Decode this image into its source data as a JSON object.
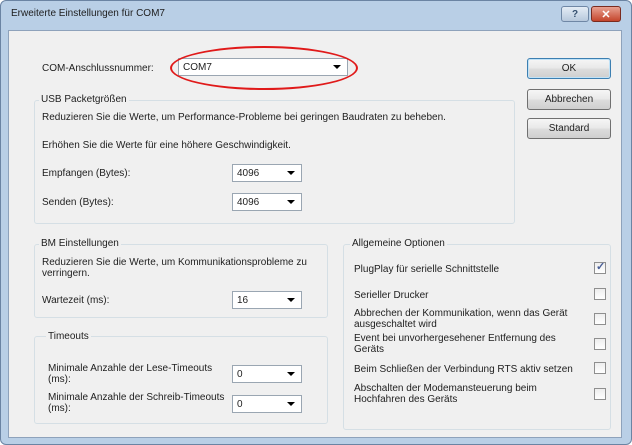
{
  "window": {
    "title": "Erweiterte Einstellungen für COM7",
    "help_icon_glyph": "?",
    "close_icon_glyph": "✕"
  },
  "com_port": {
    "label": "COM-Anschlussnummer:",
    "value": "COM7"
  },
  "usb": {
    "legend": "USB Packetgrößen",
    "text1": "Reduzieren Sie die Werte, um Performance-Probleme bei geringen Baudraten zu beheben.",
    "text2": "Erhöhen Sie die Werte für eine höhere Geschwindigkeit.",
    "receive_label": "Empfangen (Bytes):",
    "receive_value": "4096",
    "send_label": "Senden (Bytes):",
    "send_value": "4096"
  },
  "bm": {
    "legend": "BM Einstellungen",
    "text": "Reduzieren Sie die Werte, um Kommunikationsprobleme zu verringern.",
    "latency_label": "Wartezeit (ms):",
    "latency_value": "16"
  },
  "timeouts": {
    "legend": "Timeouts",
    "read_label": "Minimale Anzahle der Lese-Timeouts (ms):",
    "read_value": "0",
    "write_label": "Minimale Anzahle der Schreib-Timeouts (ms):",
    "write_value": "0"
  },
  "options": {
    "legend": "Allgemeine Optionen",
    "items": [
      {
        "label": "PlugPlay für serielle Schnittstelle",
        "checked": true
      },
      {
        "label": "Serieller Drucker",
        "checked": false
      },
      {
        "label": "Abbrechen der Kommunikation, wenn das Gerät ausgeschaltet wird",
        "checked": false
      },
      {
        "label": "Event bei unvorhergesehener Entfernung des Geräts",
        "checked": false
      },
      {
        "label": "Beim Schließen der Verbindung RTS aktiv setzen",
        "checked": false
      },
      {
        "label": "Abschalten der Modemansteuerung beim Hochfahren des Geräts",
        "checked": false
      }
    ]
  },
  "buttons": {
    "ok": "OK",
    "cancel": "Abbrechen",
    "default": "Standard"
  },
  "colors": {
    "annotation": "#e01a1a",
    "frame": "#b9cfe6",
    "check_mark": "#4a5f97"
  }
}
